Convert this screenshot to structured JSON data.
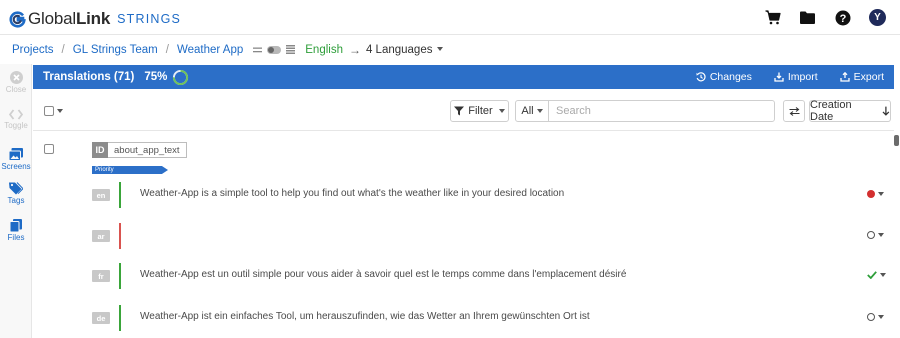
{
  "app": {
    "brand_light": "Global",
    "brand_bold": "Link",
    "brand_sub": "STRINGS",
    "avatar_initial": "Y",
    "top_icons": [
      "cart-icon",
      "folder-icon",
      "help-icon"
    ]
  },
  "breadcrumb": {
    "items": [
      "Projects",
      "GL Strings Team",
      "Weather App"
    ],
    "source_language": "English",
    "target_languages": "4 Languages"
  },
  "rail": {
    "items": [
      {
        "label": "Close",
        "icon": "close-icon",
        "enabled": false
      },
      {
        "label": "Toggle",
        "icon": "code-icon",
        "enabled": false
      },
      {
        "label": "Screens",
        "icon": "screens-icon",
        "enabled": true
      },
      {
        "label": "Tags",
        "icon": "tag-icon",
        "enabled": true
      },
      {
        "label": "Files",
        "icon": "files-icon",
        "enabled": true
      }
    ]
  },
  "header": {
    "title": "Translations (71)",
    "progress_label": "75%",
    "progress": 0.75,
    "actions": [
      {
        "label": "Changes",
        "icon": "history-icon"
      },
      {
        "label": "Import",
        "icon": "import-icon"
      },
      {
        "label": "Export",
        "icon": "export-icon"
      }
    ]
  },
  "filters": {
    "filter_label": "Filter",
    "scope_value": "All",
    "search_placeholder": "Search",
    "sort_label": "Creation Date"
  },
  "string": {
    "id_label": "ID",
    "key": "about_app_text",
    "tag": "Priority",
    "translations": [
      {
        "lang": "en",
        "text": "Weather-App is a simple tool to help you find out what's the weather like in your desired location",
        "bar_color": "#3aa53a",
        "status": "error",
        "status_color": "#d32f2f"
      },
      {
        "lang": "ar",
        "text": "",
        "bar_color": "#d9534f",
        "status": "empty",
        "status_color": "#555555"
      },
      {
        "lang": "fr",
        "text": "Weather-App est un outil simple pour vous aider à savoir quel est le temps comme dans l'emplacement désiré",
        "bar_color": "#3aa53a",
        "status": "done",
        "status_color": "#2e9e3a"
      },
      {
        "lang": "de",
        "text": "Weather-App ist ein einfaches Tool, um herauszufinden, wie das Wetter an Ihrem gewünschten Ort ist",
        "bar_color": "#3aa53a",
        "status": "empty",
        "status_color": "#555555"
      }
    ]
  },
  "colors": {
    "accent": "#2c6fc8",
    "link": "#1e6bc6",
    "source_lang": "#2e9e3a"
  }
}
